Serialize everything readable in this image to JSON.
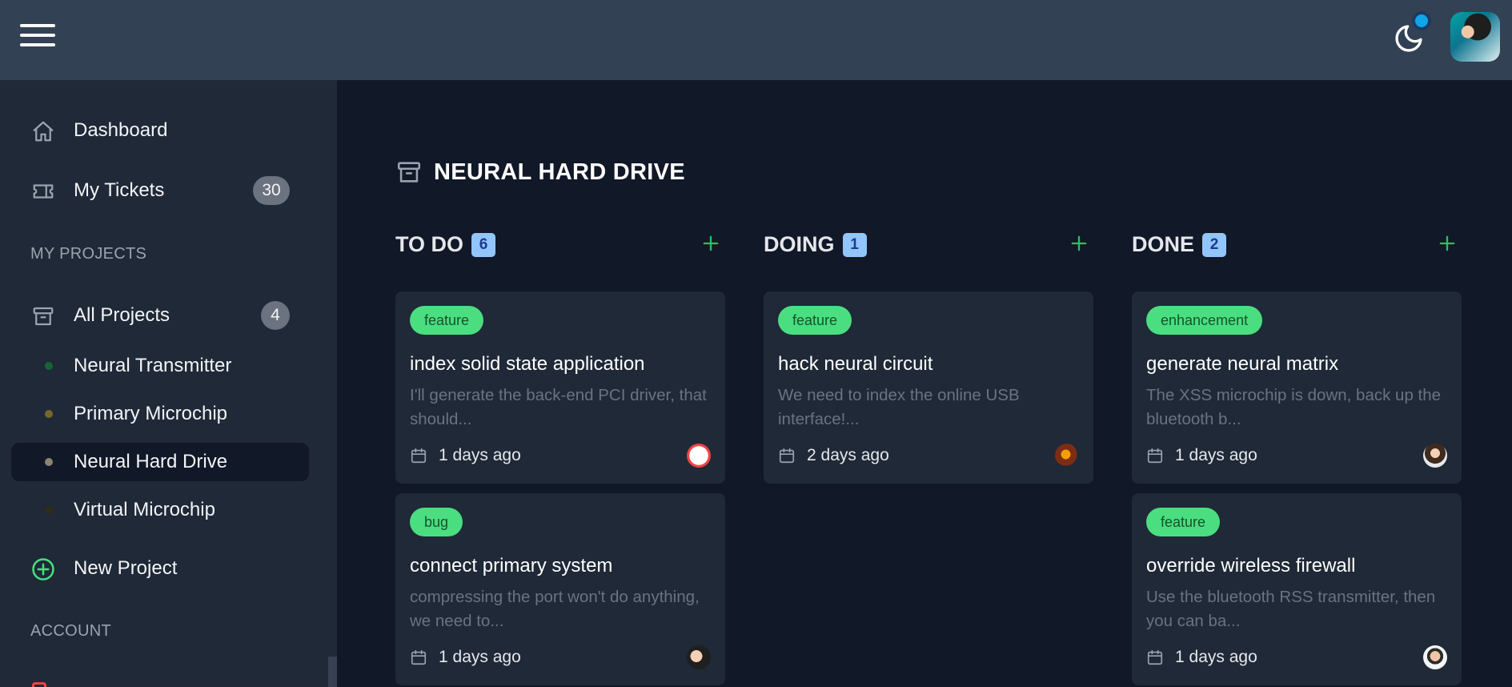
{
  "header": {
    "menu_icon": "hamburger-icon",
    "theme_icon": "moon-icon",
    "notification_color": "#0ea5e9"
  },
  "sidebar": {
    "items": [
      {
        "label": "Dashboard",
        "icon": "home-icon"
      },
      {
        "label": "My Tickets",
        "icon": "ticket-icon",
        "badge": "30"
      }
    ],
    "projects_section": "MY PROJECTS",
    "all_projects": {
      "label": "All Projects",
      "icon": "archive-icon",
      "badge": "4"
    },
    "projects": [
      {
        "label": "Neural Transmitter",
        "dot_color": "#166534"
      },
      {
        "label": "Primary Microchip",
        "dot_color": "#78662e"
      },
      {
        "label": "Neural Hard Drive",
        "dot_color": "#8a8572",
        "active": true
      },
      {
        "label": "Virtual Microchip",
        "dot_color": "#2c2e17"
      }
    ],
    "new_project": {
      "label": "New Project",
      "icon": "plus-circle-icon"
    },
    "account_section": "ACCOUNT"
  },
  "main": {
    "title": "NEURAL HARD DRIVE",
    "title_icon": "archive-icon",
    "columns": [
      {
        "name": "TO DO",
        "count": "6",
        "cards": [
          {
            "tag": "feature",
            "title": "index solid state application",
            "desc": "I'll generate the back-end PCI driver, that should...",
            "date": "1 days ago"
          },
          {
            "tag": "bug",
            "title": "connect primary system",
            "desc": "compressing the port won't do anything, we need to...",
            "date": "1 days ago"
          }
        ]
      },
      {
        "name": "DOING",
        "count": "1",
        "cards": [
          {
            "tag": "feature",
            "title": "hack neural circuit",
            "desc": "We need to index the online USB interface!...",
            "date": "2 days ago"
          }
        ]
      },
      {
        "name": "DONE",
        "count": "2",
        "cards": [
          {
            "tag": "enhancement",
            "title": "generate neural matrix",
            "desc": "The XSS microchip is down, back up the bluetooth b...",
            "date": "1 days ago"
          },
          {
            "tag": "feature",
            "title": "override wireless firewall",
            "desc": "Use the bluetooth RSS transmitter, then you can ba...",
            "date": "1 days ago"
          }
        ]
      }
    ]
  },
  "colors": {
    "accent_green": "#4ade80",
    "count_badge": "#93c5fd",
    "topbar": "#334155",
    "sidebar": "#1f2937",
    "background": "#111827"
  }
}
